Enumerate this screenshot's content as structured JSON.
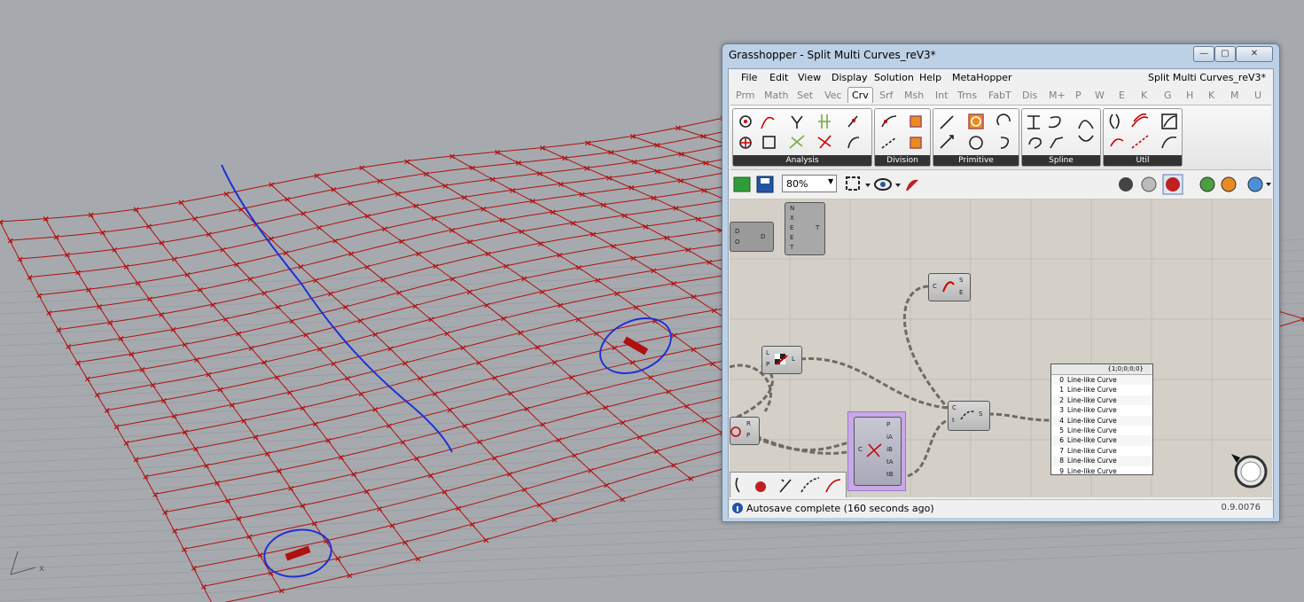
{
  "window": {
    "title": "Grasshopper - Split Multi Curves_reV3*",
    "doc_name": "Split Multi Curves_reV3*"
  },
  "window_buttons": {
    "minimize": "—",
    "maximize": "▢",
    "close": "✕"
  },
  "menus": [
    "File",
    "Edit",
    "View",
    "Display",
    "Solution",
    "Help",
    "MetaHopper"
  ],
  "tabs": [
    "Prm",
    "Math",
    "Set",
    "Vec",
    "Crv",
    "Srf",
    "Msh",
    "Int",
    "Trns",
    "FabT",
    "Dis",
    "M+",
    "P",
    "W",
    "E",
    "K",
    "G",
    "H",
    "K",
    "M",
    "U"
  ],
  "active_tab": "Crv",
  "ribbon_panels": [
    "Analysis",
    "Division",
    "Primitive",
    "Spline",
    "Util"
  ],
  "toolbar": {
    "zoom": "80%"
  },
  "panel_output": {
    "header": "{1;0;0;0;0}",
    "items": [
      {
        "index": "0",
        "label": "Line-like Curve"
      },
      {
        "index": "1",
        "label": "Line-like Curve"
      },
      {
        "index": "2",
        "label": "Line-like Curve"
      },
      {
        "index": "3",
        "label": "Line-like Curve"
      },
      {
        "index": "4",
        "label": "Line-like Curve"
      },
      {
        "index": "5",
        "label": "Line-like Curve"
      },
      {
        "index": "6",
        "label": "Line-like Curve"
      },
      {
        "index": "7",
        "label": "Line-like Curve"
      },
      {
        "index": "8",
        "label": "Line-like Curve"
      },
      {
        "index": "9",
        "label": "Line-like Curve"
      }
    ]
  },
  "nodes": {
    "a": {
      "in": [
        "D",
        "O"
      ],
      "out": [
        "D"
      ]
    },
    "b": {
      "in": [
        "N",
        "X",
        "E",
        "E",
        "T"
      ],
      "out": [
        "T"
      ]
    },
    "c": {
      "in": [
        "C"
      ],
      "out": [
        "S",
        "E"
      ]
    },
    "d": {
      "in": [
        "L",
        "P"
      ],
      "out": [
        "L"
      ]
    },
    "e": {
      "in": [
        "R",
        "P"
      ],
      "out": []
    },
    "f": {
      "in": [
        "C",
        "t"
      ],
      "out": [
        "S"
      ]
    },
    "g": {
      "in": [
        "C"
      ],
      "out": [
        "P",
        "iA",
        "iB",
        "tA",
        "tB"
      ]
    }
  },
  "status": {
    "text": "Autosave complete (160 seconds ago)",
    "version": "0.9.0076"
  },
  "viewport": {
    "axis_x": "x"
  },
  "colors": {
    "grid": "#b01010",
    "sketch": "#1f2fd6",
    "canvas": "#d4d0c8",
    "viewport_bg": "#a6aaae"
  }
}
